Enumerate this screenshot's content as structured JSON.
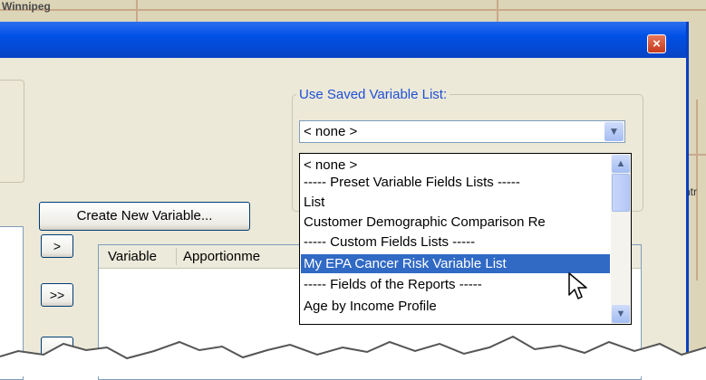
{
  "map": {
    "label_top_left": "Winnipeg",
    "label_right": "ntr"
  },
  "window": {
    "close_glyph": "×"
  },
  "saved_list": {
    "legend": "Use Saved Variable List:",
    "selected_value": "< none >",
    "options": [
      "< none >",
      "----- Preset Variable Fields Lists -----",
      "List",
      "Customer Demographic Comparison Re",
      "----- Custom Fields Lists -----",
      "My EPA Cancer Risk Variable List",
      "----- Fields of the Reports -----",
      "Age by Income Profile"
    ],
    "highlighted_index": 5
  },
  "buttons": {
    "create_new_variable": "Create New Variable...",
    "move_right": ">",
    "move_all_right": ">>",
    "move_left": "<"
  },
  "grid": {
    "columns": [
      "Variable",
      "Apportionme"
    ]
  },
  "icons": {
    "close": "close-icon",
    "dropdown": "chevron-down-icon",
    "cursor": "pointer-icon"
  },
  "colors": {
    "titlebar": "#0050e6",
    "selection": "#316ac5",
    "legend": "#1f4fd8",
    "close": "#c5391b"
  }
}
